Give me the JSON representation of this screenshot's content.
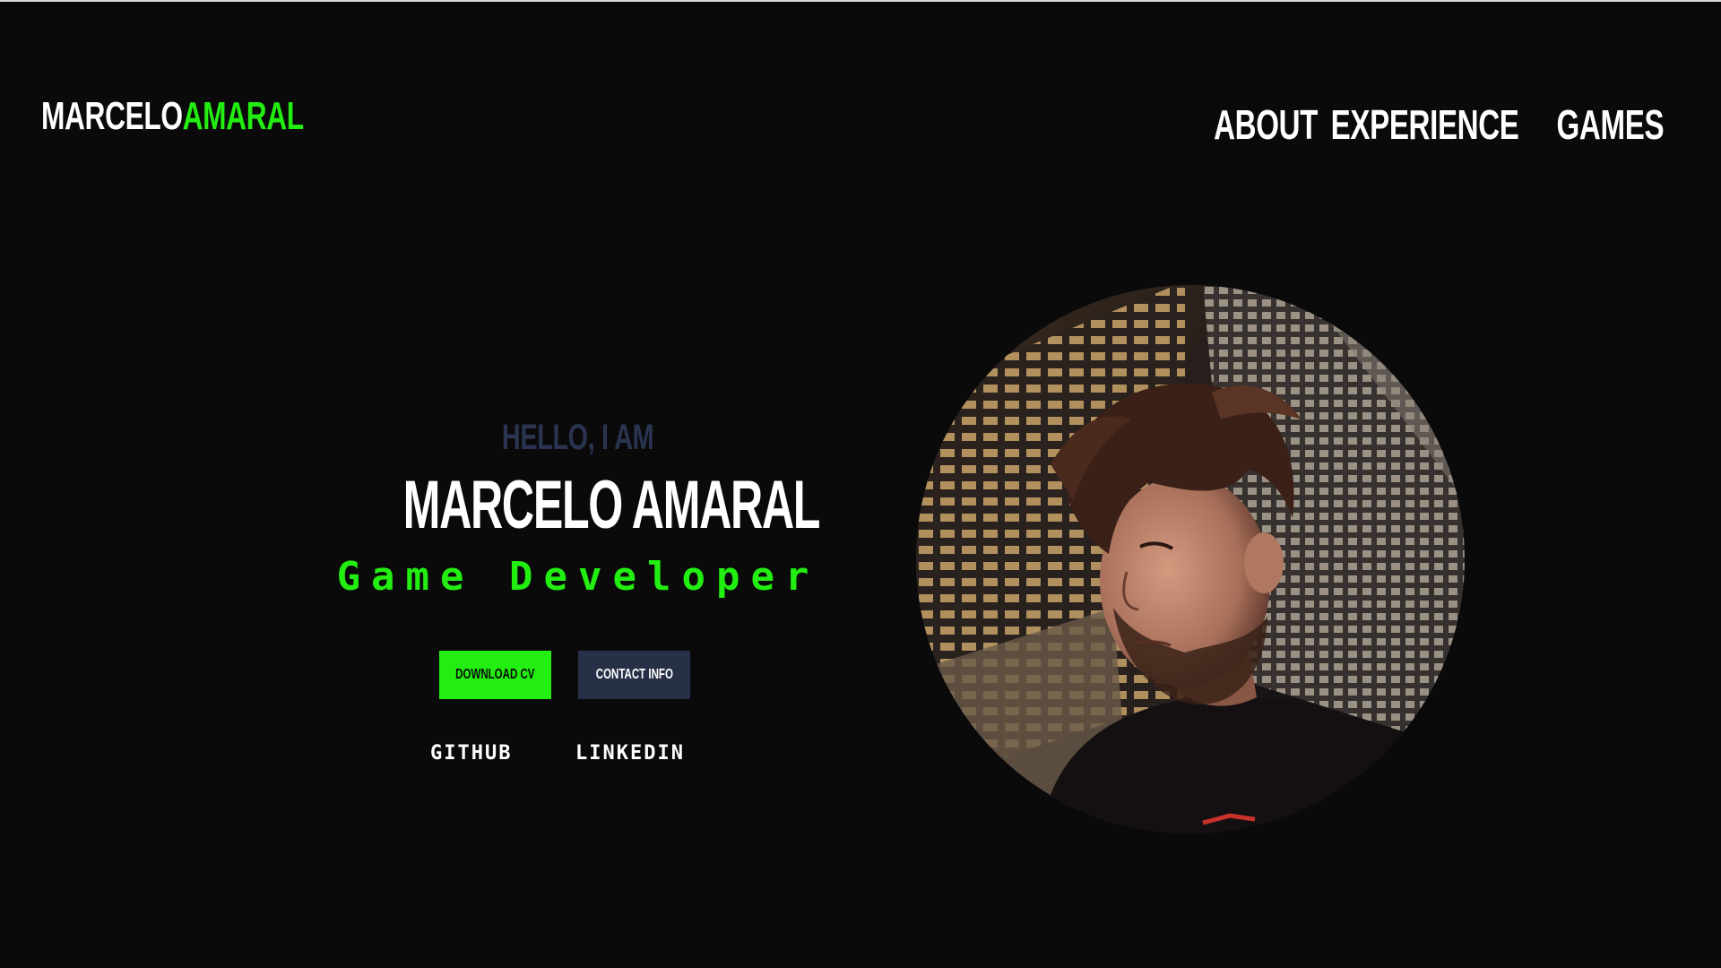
{
  "header": {
    "logo_first": "MARCELO",
    "logo_last": "AMARAL",
    "nav": {
      "about": "ABOUT",
      "experience": "EXPERIENCE",
      "games": "GAMES"
    }
  },
  "hero": {
    "greeting": "HELLO, I AM",
    "name": "MARCELO AMARAL",
    "role": "Game Developer",
    "buttons": {
      "download_cv": "DOWNLOAD CV",
      "contact_info": "CONTACT INFO"
    },
    "social": {
      "github": "GITHUB",
      "linkedin": "LINKEDIN"
    }
  },
  "colors": {
    "background": "#0a0a0b",
    "accent_green": "#22ee11",
    "muted_navy": "#283048"
  },
  "portrait": {
    "icon": "profile-photo"
  }
}
